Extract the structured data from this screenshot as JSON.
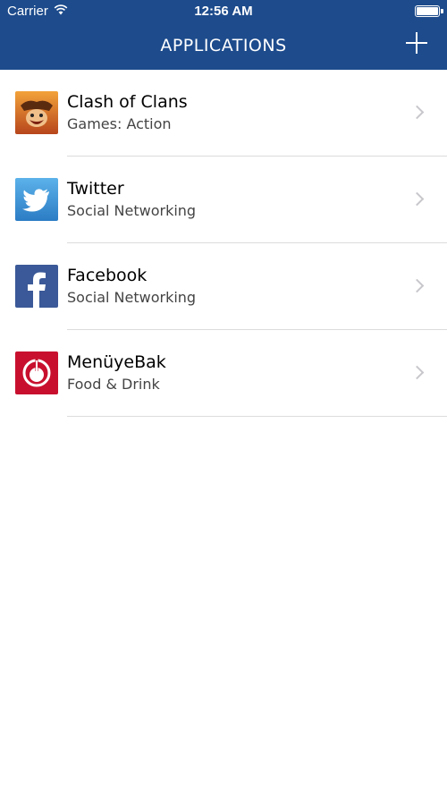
{
  "status_bar": {
    "carrier": "Carrier",
    "time": "12:56 AM"
  },
  "nav": {
    "title": "APPLICATIONS",
    "add_icon": "plus-icon"
  },
  "apps": [
    {
      "name": "Clash of Clans",
      "category": "Games: Action",
      "icon": "clash-of-clans-icon"
    },
    {
      "name": "Twitter",
      "category": "Social Networking",
      "icon": "twitter-icon"
    },
    {
      "name": "Facebook",
      "category": "Social Networking",
      "icon": "facebook-icon"
    },
    {
      "name": "MenüyeBak",
      "category": "Food & Drink",
      "icon": "menuyebak-icon"
    }
  ],
  "colors": {
    "header": "#1d4b8c",
    "twitter": "#3b93d6",
    "facebook": "#3b5998",
    "menuyebak": "#c8102e"
  }
}
